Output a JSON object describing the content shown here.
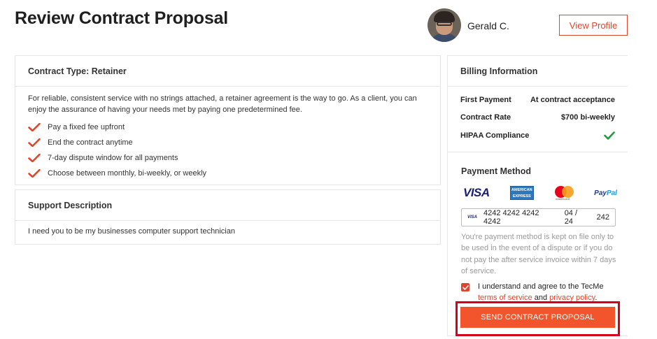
{
  "page": {
    "title": "Review Contract Proposal"
  },
  "header": {
    "user_name": "Gerald C.",
    "view_profile_label": "View Profile"
  },
  "contract": {
    "title": "Contract Type: Retainer",
    "description": "For reliable, consistent service with no strings attached, a retainer agreement is the way to go. As a client, you can enjoy the assurance of having your needs met by paying one predetermined fee.",
    "features": [
      "Pay a fixed fee upfront",
      "End the contract anytime",
      "7-day dispute window for all payments",
      "Choose between monthly, bi-weekly, or weekly"
    ]
  },
  "support": {
    "title": "Support Description",
    "text": "I need you to be my businesses computer support technician"
  },
  "billing": {
    "title": "Billing Information",
    "rows": [
      {
        "label": "First Payment",
        "value": "At contract acceptance"
      },
      {
        "label": "Contract Rate",
        "value": "$700 bi-weekly"
      },
      {
        "label": "HIPAA Compliance",
        "value": ""
      }
    ],
    "hipaa_icon": "green-check-icon"
  },
  "payment": {
    "title": "Payment Method",
    "logos": {
      "visa": "VISA",
      "amex_line1": "AMERICAN",
      "amex_line2": "EXPRESS",
      "mastercard": "mastercard",
      "paypal_1": "Pay",
      "paypal_2": "Pal"
    },
    "card": {
      "brand": "VISA",
      "number": "4242 4242 4242 4242",
      "expiry": "04 / 24",
      "cvc": "242"
    },
    "note": "You're payment method is kept on file only to be used in the event of a dispute or if you do not pay the after service invoice within 7 days of service.",
    "agree_prefix": "I understand and agree to the TecMe",
    "terms_label": "terms of service",
    "and_label": "and",
    "privacy_label": "privacy policy",
    "period": ".",
    "agree_checked": true,
    "send_label": "SEND CONTRACT PROPOSAL"
  },
  "colors": {
    "accent": "#e0452b",
    "button": "#f2552c",
    "highlight": "#d6001c",
    "check_green": "#1e9e3a"
  }
}
